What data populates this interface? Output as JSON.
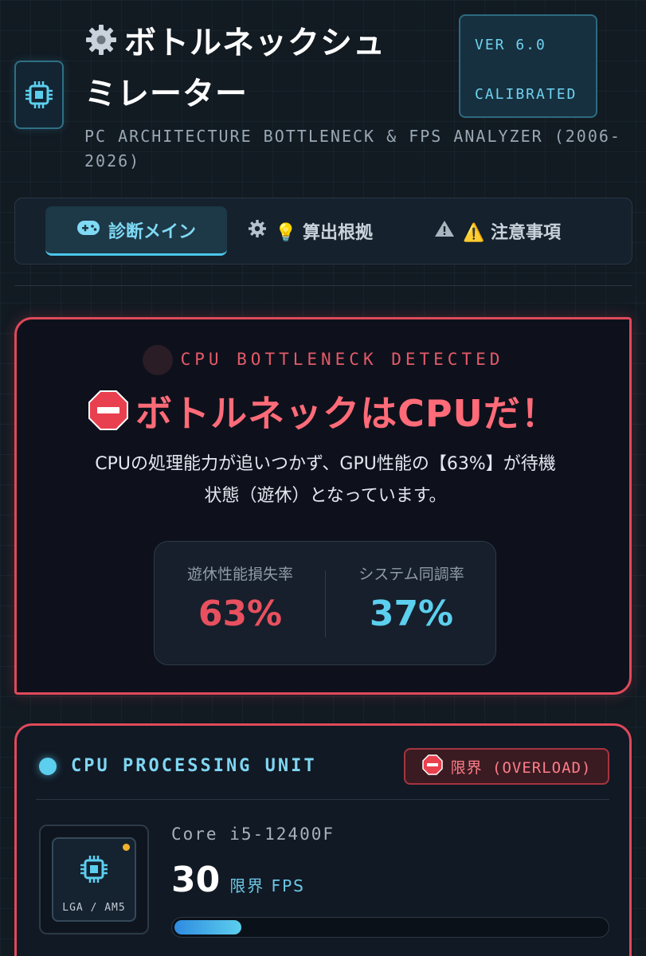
{
  "header": {
    "title_line1": "ボトルネックシュ",
    "title_line2": "ミレーター",
    "version": "VER 6.0",
    "status": "CALIBRATED",
    "subtitle_line1": "PC ARCHITECTURE BOTTLENECK & FPS ANALYZER (2006-",
    "subtitle_line2": "2026)"
  },
  "tabs": [
    {
      "label": "診断メイン",
      "icon": "gamepad-icon",
      "active": true
    },
    {
      "label": "💡 算出根拠",
      "icon": "gear-icon",
      "active": false
    },
    {
      "label": "⚠️ 注意事項",
      "icon": "warning-icon",
      "active": false
    }
  ],
  "alert": {
    "label": "CPU BOTTLENECK DETECTED",
    "title": "ボトルネックはCPUだ！",
    "desc_line1": "CPUの処理能力が追いつかず、GPU性能の【63%】が待機",
    "desc_line2": "状態（遊休）となっています。",
    "stats": [
      {
        "label": "遊休性能損失率",
        "value": "63%",
        "color": "#e8505f"
      },
      {
        "label": "システム同調率",
        "value": "37%",
        "color": "#5ccfee"
      }
    ]
  },
  "cpu": {
    "section_label": "CPU PROCESSING UNIT",
    "badge": "限界 (OVERLOAD)",
    "socket": "LGA / AM5",
    "model": "Core i5-12400F",
    "fps_value": "30",
    "fps_unit": "限界 FPS",
    "progress": 0.155
  },
  "colors": {
    "accent_cyan": "#5ccfee",
    "alert_red": "#e0495a",
    "background": "#121a22"
  }
}
